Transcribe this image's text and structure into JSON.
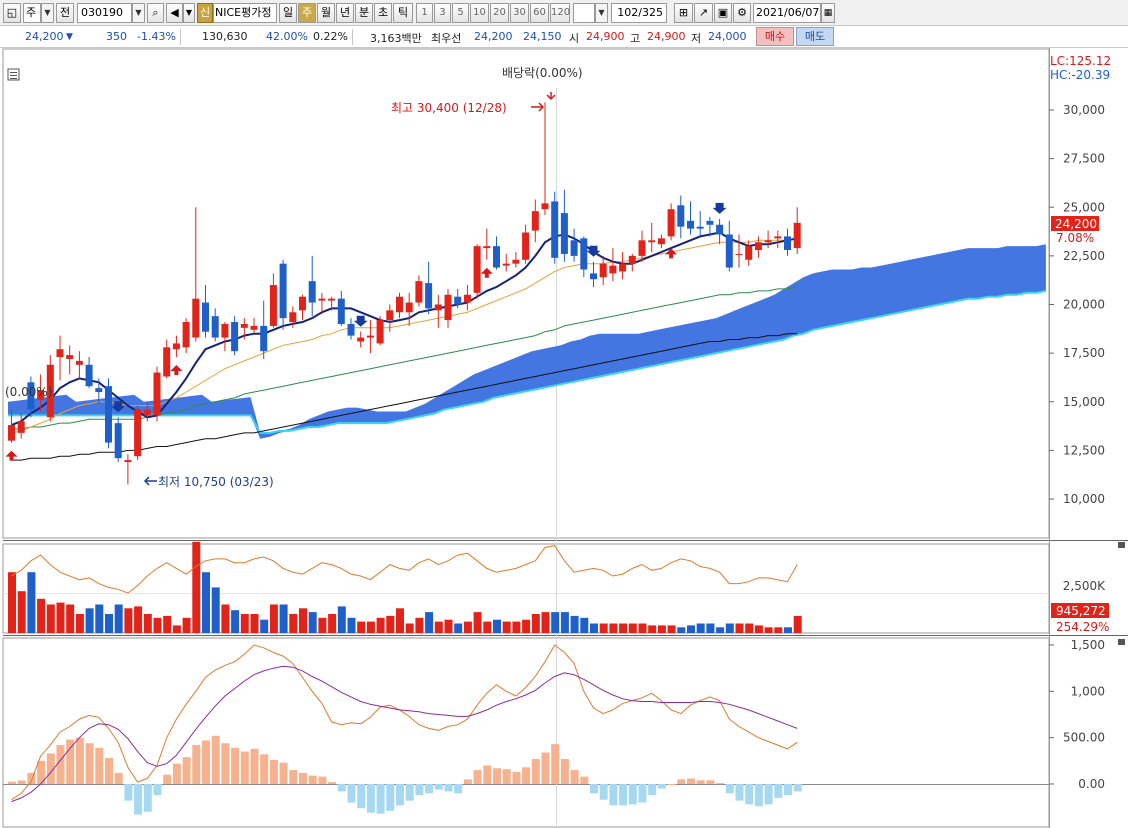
{
  "toolbar": {
    "market_select": "주",
    "prev_button": "전",
    "stock_code": "030190",
    "new_badge": "신",
    "stock_name": "NICE평가정",
    "periods": [
      "일",
      "주",
      "월",
      "년",
      "분",
      "초",
      "틱"
    ],
    "active_period": "주",
    "minute_intervals": [
      "1",
      "3",
      "5",
      "10",
      "20",
      "30",
      "60",
      "120"
    ],
    "page_counter": "102/325",
    "date": "2021/06/07"
  },
  "quote": {
    "price": "24,200",
    "change": "350",
    "change_pct": "-1.43%",
    "volume": "130,630",
    "ratio": "42.00%",
    "turnover_pct": "0.22%",
    "amount": "3,163백만",
    "best_label": "최우선",
    "best_ask": "24,200",
    "best_bid": "24,150",
    "open_label": "시",
    "open": "24,900",
    "high_label": "고",
    "high": "24,900",
    "low_label": "저",
    "low": "24,000",
    "buy_button": "매수",
    "sell_button": "매도"
  },
  "chart": {
    "lc_label": "LC:125.12",
    "hc_label": "HC:-20.39",
    "current_price": "24,200",
    "current_pct": "7.08%",
    "dividend_label": "배당락(0.00%)",
    "high_annotation": "최고 30,400 (12/28)",
    "low_annotation": "최저 10,750 (03/23)",
    "left_pct_label": "(0.00%)",
    "volume_value": "945,272",
    "volume_pct": "254.29%",
    "price_ticks": [
      "30,000",
      "27,500",
      "25,000",
      "22,500",
      "20,000",
      "17,500",
      "15,000",
      "12,500",
      "10,000"
    ],
    "volume_ticks": [
      "2,500K"
    ],
    "macd_ticks": [
      "1,500",
      "1,000",
      "500.00",
      "0.00"
    ],
    "colors": {
      "up": "#e2231a",
      "down": "#1f5fc9",
      "cloud": "#3a6fe0",
      "cloud_edge": "#39d4f0",
      "ma_short": "#13237a",
      "ma_mid": "#e6a23c",
      "ma_long": "#2e8b4a",
      "ma_longest": "#111111",
      "macd_pos": "#f6b28f",
      "macd_neg": "#a7d8f2"
    }
  },
  "chart_data": {
    "type": "candlestick",
    "ylim": [
      8000,
      31500
    ],
    "candles": [
      {
        "o": 13000,
        "h": 14600,
        "l": 12900,
        "c": 13800
      },
      {
        "o": 13400,
        "h": 14400,
        "l": 13100,
        "c": 14000
      },
      {
        "o": 16000,
        "h": 16300,
        "l": 14200,
        "c": 14600
      },
      {
        "o": 15100,
        "h": 16400,
        "l": 14500,
        "c": 15600
      },
      {
        "o": 14200,
        "h": 17400,
        "l": 14000,
        "c": 16900
      },
      {
        "o": 17300,
        "h": 18400,
        "l": 16100,
        "c": 17700
      },
      {
        "o": 17200,
        "h": 17900,
        "l": 16400,
        "c": 17400
      },
      {
        "o": 16900,
        "h": 17600,
        "l": 16200,
        "c": 17100
      },
      {
        "o": 16900,
        "h": 17300,
        "l": 15700,
        "c": 15800
      },
      {
        "o": 15700,
        "h": 16200,
        "l": 14900,
        "c": 15500
      },
      {
        "o": 15800,
        "h": 16200,
        "l": 12600,
        "c": 12900
      },
      {
        "o": 13900,
        "h": 14200,
        "l": 11900,
        "c": 12100
      },
      {
        "o": 11900,
        "h": 12300,
        "l": 10750,
        "c": 12000
      },
      {
        "o": 12200,
        "h": 14800,
        "l": 12000,
        "c": 14600
      },
      {
        "o": 14300,
        "h": 15000,
        "l": 14000,
        "c": 14600
      },
      {
        "o": 14300,
        "h": 16800,
        "l": 14000,
        "c": 16500
      },
      {
        "o": 16300,
        "h": 18200,
        "l": 16200,
        "c": 17800
      },
      {
        "o": 17700,
        "h": 18400,
        "l": 17300,
        "c": 18000
      },
      {
        "o": 17800,
        "h": 19300,
        "l": 17500,
        "c": 19100
      },
      {
        "o": 18300,
        "h": 25000,
        "l": 18100,
        "c": 20300
      },
      {
        "o": 20100,
        "h": 21000,
        "l": 18300,
        "c": 18600
      },
      {
        "o": 19400,
        "h": 19800,
        "l": 18100,
        "c": 18300
      },
      {
        "o": 18300,
        "h": 19100,
        "l": 17600,
        "c": 19000
      },
      {
        "o": 19100,
        "h": 19400,
        "l": 17400,
        "c": 17600
      },
      {
        "o": 18800,
        "h": 19300,
        "l": 18200,
        "c": 19000
      },
      {
        "o": 18700,
        "h": 19300,
        "l": 18500,
        "c": 18900
      },
      {
        "o": 18900,
        "h": 20200,
        "l": 17200,
        "c": 17600
      },
      {
        "o": 18900,
        "h": 21600,
        "l": 18800,
        "c": 21000
      },
      {
        "o": 22100,
        "h": 22300,
        "l": 18700,
        "c": 19300
      },
      {
        "o": 19100,
        "h": 19900,
        "l": 18800,
        "c": 19600
      },
      {
        "o": 19700,
        "h": 20500,
        "l": 19200,
        "c": 20400
      },
      {
        "o": 21200,
        "h": 22500,
        "l": 19400,
        "c": 20100
      },
      {
        "o": 20200,
        "h": 20600,
        "l": 19500,
        "c": 20300
      },
      {
        "o": 20200,
        "h": 20400,
        "l": 19700,
        "c": 20300
      },
      {
        "o": 20300,
        "h": 20700,
        "l": 18900,
        "c": 19000
      },
      {
        "o": 19000,
        "h": 19300,
        "l": 18200,
        "c": 18400
      },
      {
        "o": 18100,
        "h": 18600,
        "l": 17800,
        "c": 18300
      },
      {
        "o": 18300,
        "h": 19200,
        "l": 17500,
        "c": 18400
      },
      {
        "o": 18000,
        "h": 19400,
        "l": 17900,
        "c": 19200
      },
      {
        "o": 19200,
        "h": 20000,
        "l": 18600,
        "c": 19700
      },
      {
        "o": 19600,
        "h": 20600,
        "l": 19300,
        "c": 20400
      },
      {
        "o": 19600,
        "h": 20600,
        "l": 18900,
        "c": 20100
      },
      {
        "o": 20100,
        "h": 21500,
        "l": 19900,
        "c": 21200
      },
      {
        "o": 21100,
        "h": 22200,
        "l": 19500,
        "c": 19800
      },
      {
        "o": 19700,
        "h": 20500,
        "l": 18800,
        "c": 20000
      },
      {
        "o": 19200,
        "h": 20800,
        "l": 18800,
        "c": 20500
      },
      {
        "o": 20400,
        "h": 20800,
        "l": 19800,
        "c": 20000
      },
      {
        "o": 20100,
        "h": 21000,
        "l": 19700,
        "c": 20500
      },
      {
        "o": 20600,
        "h": 23100,
        "l": 20300,
        "c": 23000
      },
      {
        "o": 22900,
        "h": 23900,
        "l": 22300,
        "c": 23000
      },
      {
        "o": 23000,
        "h": 23500,
        "l": 21800,
        "c": 21900
      },
      {
        "o": 22000,
        "h": 22600,
        "l": 21700,
        "c": 22100
      },
      {
        "o": 22100,
        "h": 22700,
        "l": 21900,
        "c": 22300
      },
      {
        "o": 22300,
        "h": 24100,
        "l": 22100,
        "c": 23700
      },
      {
        "o": 23800,
        "h": 25400,
        "l": 23200,
        "c": 24800
      },
      {
        "o": 24900,
        "h": 30400,
        "l": 24600,
        "c": 25200
      },
      {
        "o": 25300,
        "h": 25800,
        "l": 22100,
        "c": 22400
      },
      {
        "o": 24700,
        "h": 25900,
        "l": 22200,
        "c": 22600
      },
      {
        "o": 23300,
        "h": 23900,
        "l": 22200,
        "c": 22500
      },
      {
        "o": 23400,
        "h": 23500,
        "l": 21400,
        "c": 21800
      },
      {
        "o": 21600,
        "h": 22200,
        "l": 20900,
        "c": 21300
      },
      {
        "o": 21400,
        "h": 22500,
        "l": 21000,
        "c": 22100
      },
      {
        "o": 21600,
        "h": 22900,
        "l": 21200,
        "c": 22000
      },
      {
        "o": 21700,
        "h": 22700,
        "l": 21300,
        "c": 22100
      },
      {
        "o": 22100,
        "h": 22600,
        "l": 21700,
        "c": 22500
      },
      {
        "o": 22500,
        "h": 23800,
        "l": 22200,
        "c": 23300
      },
      {
        "o": 23200,
        "h": 24200,
        "l": 22700,
        "c": 23300
      },
      {
        "o": 23100,
        "h": 23600,
        "l": 22900,
        "c": 23400
      },
      {
        "o": 23500,
        "h": 25200,
        "l": 23300,
        "c": 24900
      },
      {
        "o": 25100,
        "h": 25600,
        "l": 23400,
        "c": 24000
      },
      {
        "o": 24300,
        "h": 25300,
        "l": 23600,
        "c": 23900
      },
      {
        "o": 24000,
        "h": 24800,
        "l": 23500,
        "c": 23900
      },
      {
        "o": 24300,
        "h": 24500,
        "l": 23500,
        "c": 24100
      },
      {
        "o": 24100,
        "h": 24400,
        "l": 23100,
        "c": 23600
      },
      {
        "o": 23600,
        "h": 24300,
        "l": 21700,
        "c": 21900
      },
      {
        "o": 22600,
        "h": 23600,
        "l": 21900,
        "c": 22600
      },
      {
        "o": 22300,
        "h": 23300,
        "l": 22000,
        "c": 23000
      },
      {
        "o": 22800,
        "h": 23500,
        "l": 22400,
        "c": 23200
      },
      {
        "o": 23200,
        "h": 23800,
        "l": 22900,
        "c": 23300
      },
      {
        "o": 23400,
        "h": 23800,
        "l": 22900,
        "c": 23500
      },
      {
        "o": 23500,
        "h": 23900,
        "l": 22500,
        "c": 22800
      },
      {
        "o": 22900,
        "h": 25000,
        "l": 22600,
        "c": 24200
      }
    ],
    "ma_short": [
      13800,
      14000,
      14400,
      14700,
      15100,
      15700,
      16000,
      16200,
      16100,
      16000,
      15600,
      15200,
      14800,
      14500,
      14200,
      14300,
      14900,
      15500,
      16200,
      17000,
      17700,
      17900,
      18100,
      18200,
      18400,
      18500,
      18500,
      18700,
      18900,
      19000,
      19100,
      19300,
      19600,
      19800,
      19800,
      19800,
      19600,
      19400,
      19200,
      19100,
      19200,
      19300,
      19600,
      19700,
      19800,
      19900,
      20000,
      20100,
      20400,
      20700,
      20900,
      21200,
      21500,
      21900,
      22500,
      23200,
      23500,
      23600,
      23400,
      23100,
      22700,
      22400,
      22200,
      22100,
      22100,
      22300,
      22500,
      22700,
      22900,
      23100,
      23300,
      23500,
      23600,
      23700,
      23400,
      23200,
      23000,
      23100,
      23100,
      23200,
      23300,
      23400
    ],
    "ma_mid": [
      13400,
      13500,
      13700,
      13900,
      14100,
      14400,
      14600,
      14800,
      14900,
      15000,
      15000,
      14900,
      14800,
      14800,
      14800,
      14800,
      15000,
      15200,
      15500,
      15800,
      16100,
      16400,
      16700,
      16900,
      17100,
      17300,
      17500,
      17700,
      17900,
      18000,
      18100,
      18200,
      18400,
      18500,
      18700,
      18800,
      18800,
      18800,
      18800,
      18800,
      18900,
      19000,
      19100,
      19200,
      19300,
      19400,
      19500,
      19600,
      19800,
      20000,
      20200,
      20400,
      20600,
      20800,
      21100,
      21400,
      21700,
      21900,
      22000,
      22100,
      22100,
      22100,
      22200,
      22200,
      22300,
      22400,
      22500,
      22600,
      22700,
      22800,
      22900,
      23000,
      23100,
      23200,
      23200,
      23200,
      23200,
      23300,
      23300,
      23300,
      23300,
      23400
    ],
    "ma_long": [
      13600,
      13600,
      13700,
      13700,
      13800,
      13900,
      13900,
      14000,
      14100,
      14100,
      14100,
      14100,
      14100,
      14100,
      14200,
      14300,
      14400,
      14500,
      14600,
      14800,
      14900,
      15000,
      15100,
      15200,
      15400,
      15500,
      15600,
      15700,
      15800,
      15900,
      16000,
      16100,
      16200,
      16300,
      16400,
      16500,
      16600,
      16700,
      16800,
      16900,
      17000,
      17100,
      17200,
      17300,
      17400,
      17500,
      17600,
      17700,
      17800,
      17900,
      18000,
      18100,
      18200,
      18300,
      18400,
      18600,
      18700,
      18900,
      19000,
      19100,
      19200,
      19300,
      19400,
      19500,
      19600,
      19700,
      19800,
      19900,
      20000,
      20100,
      20200,
      20300,
      20400,
      20500,
      20500,
      20600,
      20600,
      20700,
      20700,
      20800,
      20800,
      20900
    ],
    "ma_longest": [
      12000,
      12000,
      12100,
      12100,
      12100,
      12200,
      12200,
      12300,
      12300,
      12400,
      12400,
      12400,
      12500,
      12500,
      12600,
      12700,
      12700,
      12800,
      12900,
      13000,
      13100,
      13100,
      13200,
      13300,
      13400,
      13400,
      13500,
      13600,
      13700,
      13800,
      13900,
      14000,
      14100,
      14200,
      14300,
      14400,
      14500,
      14600,
      14700,
      14800,
      14900,
      15000,
      15100,
      15200,
      15300,
      15400,
      15500,
      15600,
      15700,
      15800,
      15900,
      16000,
      16100,
      16200,
      16300,
      16400,
      16500,
      16600,
      16700,
      16800,
      16900,
      17000,
      17100,
      17200,
      17300,
      17400,
      17500,
      17600,
      17700,
      17800,
      17900,
      18000,
      18100,
      18100,
      18200,
      18200,
      18300,
      18300,
      18400,
      18400,
      18500,
      18500
    ],
    "volume": [
      3.2,
      2.2,
      3.2,
      1.8,
      1.5,
      1.6,
      1.5,
      1.0,
      1.3,
      1.5,
      1.0,
      1.5,
      1.3,
      1.4,
      1.0,
      0.8,
      0.9,
      0.4,
      0.8,
      4.8,
      3.2,
      2.4,
      1.5,
      1.2,
      1.0,
      1.0,
      0.7,
      1.5,
      1.5,
      1.0,
      1.3,
      1.1,
      0.8,
      1.0,
      1.4,
      0.8,
      0.6,
      0.6,
      0.8,
      0.9,
      1.3,
      0.5,
      0.8,
      1.1,
      0.6,
      0.7,
      0.5,
      0.6,
      1.1,
      0.6,
      0.7,
      0.6,
      0.6,
      0.7,
      1.0,
      1.1,
      1.1,
      1.1,
      0.9,
      0.8,
      0.5,
      0.5,
      0.5,
      0.5,
      0.5,
      0.5,
      0.4,
      0.4,
      0.4,
      0.3,
      0.4,
      0.5,
      0.5,
      0.3,
      0.5,
      0.5,
      0.5,
      0.4,
      0.3,
      0.3,
      0.3,
      0.9
    ],
    "volume_line": [
      3.0,
      3.3,
      3.8,
      4.1,
      3.6,
      3.2,
      3.0,
      2.8,
      2.9,
      2.6,
      2.4,
      2.3,
      2.1,
      2.5,
      3.0,
      3.4,
      3.7,
      3.4,
      3.1,
      3.5,
      3.8,
      3.9,
      3.9,
      3.7,
      3.7,
      3.9,
      4.0,
      3.8,
      3.4,
      3.2,
      3.1,
      3.4,
      3.7,
      3.6,
      3.4,
      3.1,
      3.0,
      2.8,
      3.2,
      3.6,
      3.4,
      3.3,
      3.7,
      3.9,
      3.6,
      3.8,
      4.1,
      4.2,
      3.8,
      3.4,
      3.2,
      3.3,
      3.4,
      3.6,
      3.8,
      4.5,
      4.6,
      3.8,
      3.2,
      3.3,
      3.4,
      3.3,
      3.0,
      3.1,
      3.4,
      3.6,
      3.3,
      3.4,
      3.7,
      3.9,
      3.8,
      3.5,
      3.4,
      3.2,
      2.6,
      2.6,
      2.7,
      2.9,
      2.9,
      2.8,
      2.7,
      3.6
    ],
    "macd_hist": [
      25,
      38,
      120,
      250,
      330,
      420,
      480,
      500,
      440,
      390,
      280,
      120,
      -180,
      -330,
      -300,
      -120,
      100,
      220,
      290,
      420,
      470,
      520,
      440,
      390,
      350,
      380,
      320,
      260,
      230,
      150,
      120,
      90,
      80,
      20,
      -80,
      -200,
      -260,
      -310,
      -320,
      -290,
      -230,
      -180,
      -120,
      -100,
      -60,
      -80,
      -100,
      50,
      150,
      200,
      170,
      160,
      130,
      180,
      270,
      340,
      430,
      270,
      150,
      80,
      -100,
      -170,
      -230,
      -230,
      -220,
      -200,
      -120,
      -50,
      0,
      50,
      60,
      40,
      40,
      10,
      -100,
      -180,
      -220,
      -240,
      -220,
      -150,
      -120,
      -80
    ],
    "macd_line": [
      -170,
      -100,
      20,
      300,
      420,
      560,
      620,
      700,
      740,
      720,
      600,
      450,
      180,
      20,
      60,
      200,
      500,
      700,
      860,
      1000,
      1150,
      1230,
      1280,
      1320,
      1400,
      1500,
      1470,
      1420,
      1380,
      1300,
      1150,
      1000,
      870,
      670,
      640,
      660,
      650,
      720,
      830,
      850,
      800,
      730,
      640,
      600,
      580,
      620,
      640,
      700,
      850,
      980,
      1070,
      1000,
      950,
      1040,
      1160,
      1320,
      1500,
      1420,
      1300,
      1000,
      820,
      760,
      800,
      870,
      900,
      930,
      980,
      900,
      800,
      760,
      850,
      900,
      940,
      900,
      700,
      620,
      560,
      500,
      460,
      420,
      380,
      450
    ],
    "macd_signal": [
      -190,
      -150,
      -90,
      0,
      120,
      250,
      380,
      500,
      600,
      650,
      640,
      590,
      490,
      350,
      230,
      190,
      220,
      310,
      450,
      590,
      720,
      840,
      950,
      1030,
      1110,
      1180,
      1220,
      1250,
      1270,
      1260,
      1220,
      1160,
      1110,
      1050,
      990,
      940,
      890,
      860,
      840,
      820,
      800,
      790,
      780,
      760,
      750,
      740,
      730,
      730,
      760,
      800,
      850,
      890,
      920,
      960,
      1010,
      1090,
      1160,
      1200,
      1180,
      1130,
      1070,
      1010,
      960,
      920,
      900,
      890,
      890,
      880,
      880,
      880,
      880,
      890,
      890,
      880,
      860,
      830,
      800,
      760,
      720,
      680,
      640,
      600
    ]
  }
}
